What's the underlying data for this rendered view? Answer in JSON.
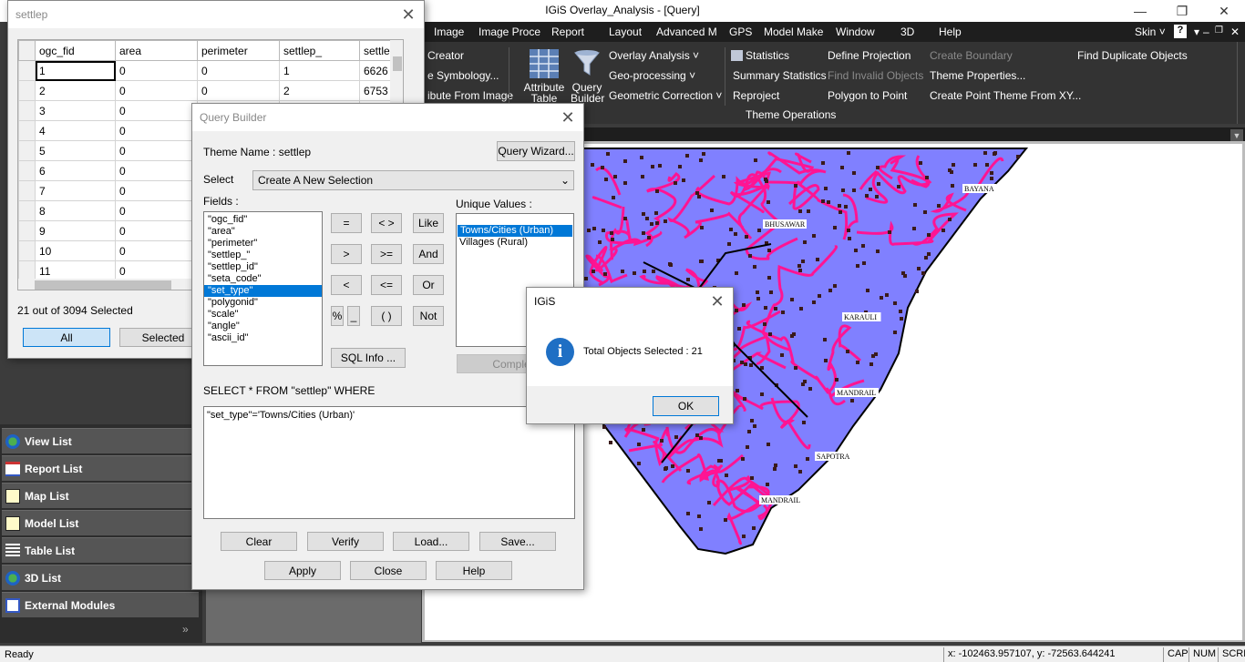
{
  "app": {
    "title": "IGiS Overlay_Analysis - [Query]",
    "window_controls": {
      "minimize": "—",
      "restore": "❐",
      "close": "✕"
    },
    "mdi_controls": {
      "minimize": "–",
      "restore": "❐",
      "close": "✕"
    }
  },
  "menubar": {
    "items": [
      "Image",
      "Image Proce",
      "Report",
      "Layout",
      "Advanced M",
      "GPS",
      "Model Make",
      "Window",
      "3D",
      "Help"
    ],
    "skin_label": "Skin",
    "help_icon": "?"
  },
  "ribbon": {
    "col1": [
      "Creator",
      "e Symbology...",
      "ibute From Image"
    ],
    "attribute_table": "Attribute Table",
    "query_builder": "Query Builder",
    "col3": [
      "Overlay Analysis",
      "Geo-processing",
      "Geometric Correction"
    ],
    "col4": [
      "Statistics",
      "Summary Statistics",
      "Reproject"
    ],
    "col5": [
      "Define Projection",
      "Find Invalid Objects",
      "Polygon to Point"
    ],
    "col6": [
      "Create Boundary",
      "Theme Properties...",
      "Create Point Theme From XY..."
    ],
    "col7": [
      "Find Duplicate Objects"
    ],
    "group_label": "Theme Operations"
  },
  "settlep_window": {
    "title": "settlep",
    "columns": [
      "ogc_fid",
      "area",
      "perimeter",
      "settlep_",
      "settle"
    ],
    "rows": [
      [
        "1",
        "0",
        "0",
        "1",
        "6626"
      ],
      [
        "2",
        "0",
        "0",
        "2",
        "6753"
      ],
      [
        "3",
        "0",
        "",
        "",
        ""
      ],
      [
        "4",
        "0",
        "",
        "",
        ""
      ],
      [
        "5",
        "0",
        "",
        "",
        ""
      ],
      [
        "6",
        "0",
        "",
        "",
        ""
      ],
      [
        "7",
        "0",
        "",
        "",
        ""
      ],
      [
        "8",
        "0",
        "",
        "",
        ""
      ],
      [
        "9",
        "0",
        "",
        "",
        ""
      ],
      [
        "10",
        "0",
        "",
        "",
        ""
      ],
      [
        "11",
        "0",
        "",
        "",
        ""
      ]
    ],
    "selection_status": "21 out of 3094 Selected",
    "all_button": "All",
    "selected_button": "Selected"
  },
  "query_builder": {
    "title": "Query Builder",
    "theme_name_label": "Theme Name : settlep",
    "query_wizard_button": "Query Wizard...",
    "select_label": "Select",
    "select_value": "Create A New Selection",
    "fields_label": "Fields :",
    "fields": [
      "\"ogc_fid\"",
      "\"area\"",
      "\"perimeter\"",
      "\"settlep_\"",
      "\"settlep_id\"",
      "\"seta_code\"",
      "\"set_type\"",
      "\"polygonid\"",
      "\"scale\"",
      "\"angle\"",
      "\"ascii_id\""
    ],
    "selected_field_index": 6,
    "operators": [
      "=",
      "< >",
      "Like",
      ">",
      ">=",
      "And",
      "<",
      "<=",
      "Or",
      "%",
      "_",
      "( )",
      "Not"
    ],
    "sql_info_button": "SQL Info ...",
    "unique_values_label": "Unique Values :",
    "unique_values": [
      "Towns/Cities (Urban)",
      "Villages (Rural)"
    ],
    "selected_unique_index": 0,
    "complete_button": "Complete",
    "sql_prefix": "SELECT * FROM \"settlep\" WHERE",
    "sql_expression": "\"set_type\"='Towns/Cities (Urban)'",
    "buttons": {
      "clear": "Clear",
      "verify": "Verify",
      "load": "Load...",
      "save": "Save...",
      "apply": "Apply",
      "close": "Close",
      "help": "Help"
    }
  },
  "message_box": {
    "title": "IGiS",
    "icon": "info-icon",
    "message": "Total Objects Selected : 21",
    "ok_button": "OK"
  },
  "left_panel": {
    "items": [
      "View List",
      "Report List",
      "Map List",
      "Model List",
      "Table List",
      "3D List",
      "External Modules"
    ],
    "expand_glyph": "»"
  },
  "map": {
    "labels": [
      "BAYANA",
      "BHUSAWAR",
      "KARAULI",
      "MANDRAIL",
      "SAPOTRA",
      "MANDRAIL"
    ],
    "colors": {
      "land": "#8080ff",
      "roads": "#ff1493",
      "boundary": "#000000",
      "background": "#ffffff"
    }
  },
  "statusbar": {
    "ready": "Ready",
    "coords": "x: -102463.957107,   y: -72563.644241",
    "cap": "CAP",
    "num": "NUM",
    "scrl": "SCRL"
  }
}
